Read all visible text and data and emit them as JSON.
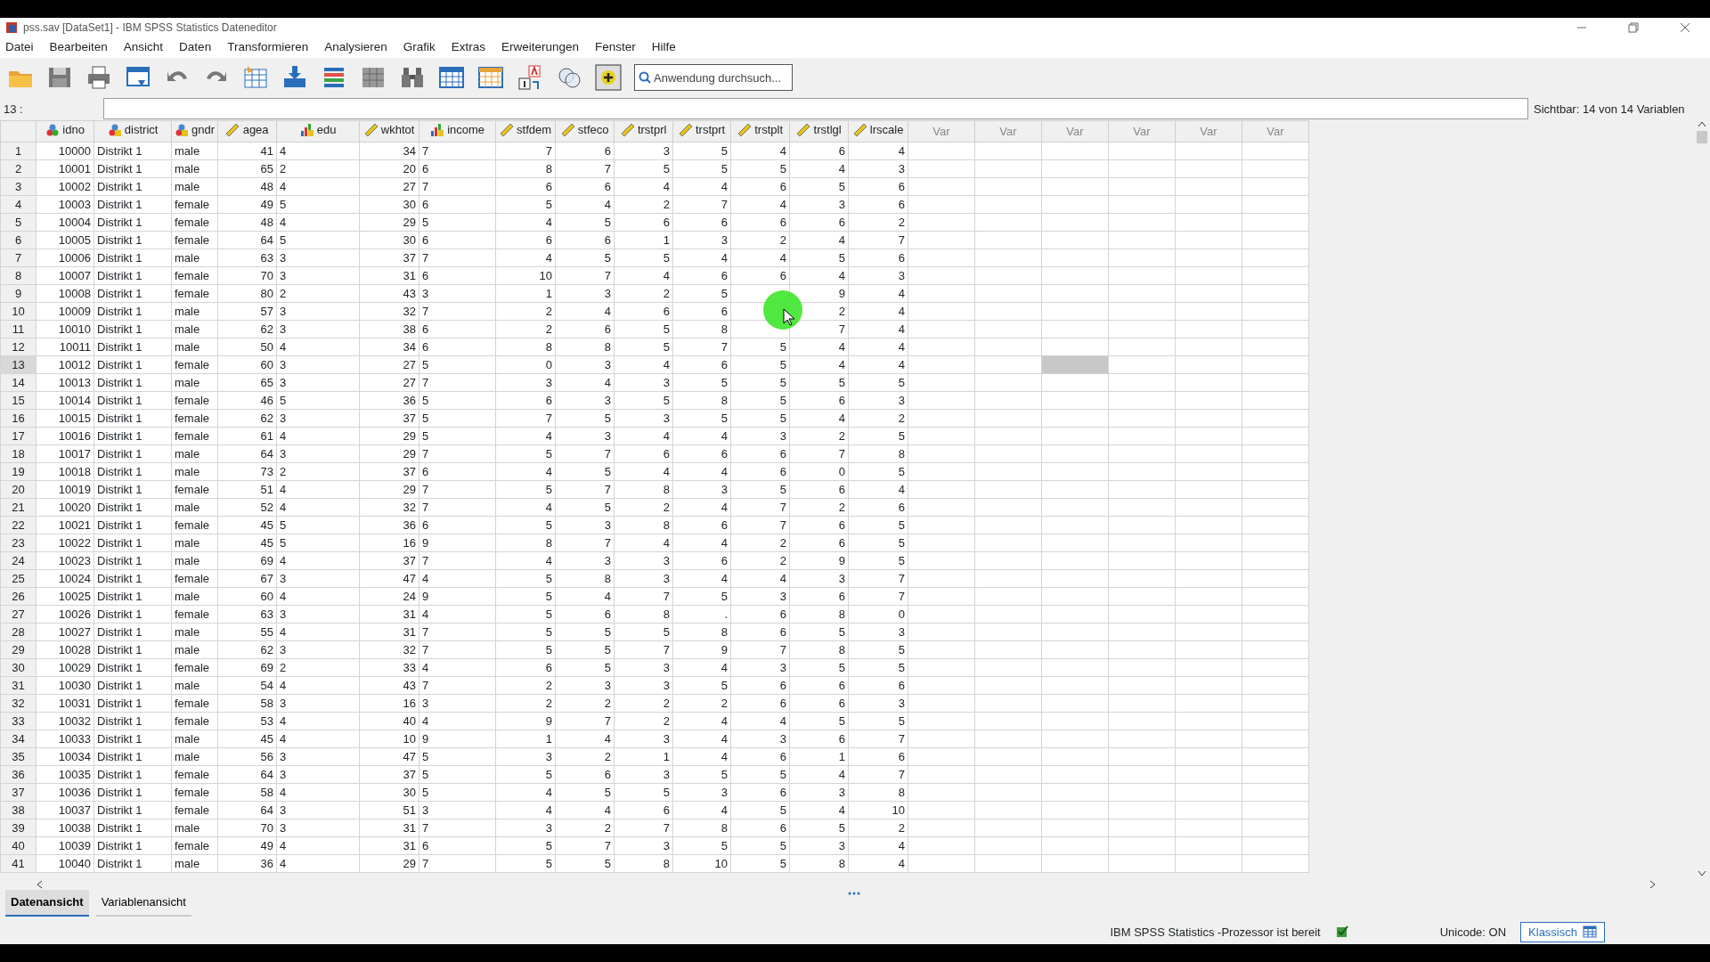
{
  "window": {
    "title": "pss.sav [DataSet1] - IBM SPSS Statistics Dateneditor"
  },
  "menu": [
    {
      "label": "Datei"
    },
    {
      "label": "Bearbeiten"
    },
    {
      "label": "Ansicht"
    },
    {
      "label": "Daten"
    },
    {
      "label": "Transformieren"
    },
    {
      "label": "Analysieren"
    },
    {
      "label": "Grafik"
    },
    {
      "label": "Extras"
    },
    {
      "label": "Erweiterungen"
    },
    {
      "label": "Fenster"
    },
    {
      "label": "Hilfe"
    }
  ],
  "search": {
    "placeholder": "Anwendung durchsuch..."
  },
  "cell_editor": {
    "label": "13 :"
  },
  "visible_info": "Sichtbar: 14 von 14 Variablen",
  "columns": [
    {
      "name": "idno",
      "kind": "nominal"
    },
    {
      "name": "district",
      "kind": "nominal_string"
    },
    {
      "name": "gndr",
      "kind": "nominal_string"
    },
    {
      "name": "agea",
      "kind": "scale"
    },
    {
      "name": "edu",
      "kind": "ordinal_string"
    },
    {
      "name": "wkhtot",
      "kind": "scale"
    },
    {
      "name": "income",
      "kind": "ordinal_string"
    },
    {
      "name": "stfdem",
      "kind": "scale"
    },
    {
      "name": "stfeco",
      "kind": "scale"
    },
    {
      "name": "trstprl",
      "kind": "scale"
    },
    {
      "name": "trstprt",
      "kind": "scale"
    },
    {
      "name": "trstplt",
      "kind": "scale"
    },
    {
      "name": "trstlgl",
      "kind": "scale"
    },
    {
      "name": "lrscale",
      "kind": "scale"
    }
  ],
  "var_columns": [
    {
      "label": "Var",
      "selected": false
    },
    {
      "label": "Var",
      "selected": false
    },
    {
      "label": "Var",
      "selected": true
    },
    {
      "label": "Var",
      "selected": false
    },
    {
      "label": "Var",
      "selected": false
    },
    {
      "label": "Var",
      "selected": false
    }
  ],
  "rows": [
    {
      "label": "1",
      "selected": false,
      "cells": [
        "10000",
        "Distrikt 1",
        "male",
        "41",
        "4",
        "34",
        "7",
        "7",
        "6",
        "3",
        "5",
        "4",
        "6",
        "4"
      ]
    },
    {
      "label": "2",
      "selected": false,
      "cells": [
        "10001",
        "Distrikt 1",
        "male",
        "65",
        "2",
        "20",
        "6",
        "8",
        "7",
        "5",
        "5",
        "5",
        "4",
        "3"
      ]
    },
    {
      "label": "3",
      "selected": false,
      "cells": [
        "10002",
        "Distrikt 1",
        "male",
        "48",
        "4",
        "27",
        "7",
        "6",
        "6",
        "4",
        "4",
        "6",
        "5",
        "6"
      ]
    },
    {
      "label": "4",
      "selected": false,
      "cells": [
        "10003",
        "Distrikt 1",
        "female",
        "49",
        "5",
        "30",
        "6",
        "5",
        "4",
        "2",
        "7",
        "4",
        "3",
        "6"
      ]
    },
    {
      "label": "5",
      "selected": false,
      "cells": [
        "10004",
        "Distrikt 1",
        "female",
        "48",
        "4",
        "29",
        "5",
        "4",
        "5",
        "6",
        "6",
        "6",
        "6",
        "2"
      ]
    },
    {
      "label": "6",
      "selected": false,
      "cells": [
        "10005",
        "Distrikt 1",
        "female",
        "64",
        "5",
        "30",
        "6",
        "6",
        "6",
        "1",
        "3",
        "2",
        "4",
        "7"
      ]
    },
    {
      "label": "7",
      "selected": false,
      "cells": [
        "10006",
        "Distrikt 1",
        "male",
        "63",
        "3",
        "37",
        "7",
        "4",
        "5",
        "5",
        "4",
        "4",
        "5",
        "6"
      ]
    },
    {
      "label": "8",
      "selected": false,
      "cells": [
        "10007",
        "Distrikt 1",
        "female",
        "70",
        "3",
        "31",
        "6",
        "10",
        "7",
        "4",
        "6",
        "6",
        "4",
        "3"
      ]
    },
    {
      "label": "9",
      "selected": false,
      "cells": [
        "10008",
        "Distrikt 1",
        "female",
        "80",
        "2",
        "43",
        "3",
        "1",
        "3",
        "2",
        "5",
        null,
        "9",
        "4"
      ]
    },
    {
      "label": "10",
      "selected": false,
      "cells": [
        "10009",
        "Distrikt 1",
        "male",
        "57",
        "3",
        "32",
        "7",
        "2",
        "4",
        "6",
        "6",
        null,
        "2",
        "4"
      ]
    },
    {
      "label": "11",
      "selected": false,
      "cells": [
        "10010",
        "Distrikt 1",
        "male",
        "62",
        "3",
        "38",
        "6",
        "2",
        "6",
        "5",
        "8",
        null,
        "7",
        "4"
      ]
    },
    {
      "label": "12",
      "selected": false,
      "cells": [
        "10011",
        "Distrikt 1",
        "male",
        "50",
        "4",
        "34",
        "6",
        "8",
        "8",
        "5",
        "7",
        "5",
        "4",
        "4"
      ]
    },
    {
      "label": "13",
      "selected": true,
      "cells": [
        "10012",
        "Distrikt 1",
        "female",
        "60",
        "3",
        "27",
        "5",
        "0",
        "3",
        "4",
        "6",
        "5",
        "4",
        "4"
      ]
    },
    {
      "label": "14",
      "selected": false,
      "cells": [
        "10013",
        "Distrikt 1",
        "male",
        "65",
        "3",
        "27",
        "7",
        "3",
        "4",
        "3",
        "5",
        "5",
        "5",
        "5"
      ]
    },
    {
      "label": "15",
      "selected": false,
      "cells": [
        "10014",
        "Distrikt 1",
        "female",
        "46",
        "5",
        "36",
        "5",
        "6",
        "3",
        "5",
        "8",
        "5",
        "6",
        "3"
      ]
    },
    {
      "label": "16",
      "selected": false,
      "cells": [
        "10015",
        "Distrikt 1",
        "female",
        "62",
        "3",
        "37",
        "5",
        "7",
        "5",
        "3",
        "5",
        "5",
        "4",
        "2"
      ]
    },
    {
      "label": "17",
      "selected": false,
      "cells": [
        "10016",
        "Distrikt 1",
        "female",
        "61",
        "4",
        "29",
        "5",
        "4",
        "3",
        "4",
        "4",
        "3",
        "2",
        "5"
      ]
    },
    {
      "label": "18",
      "selected": false,
      "cells": [
        "10017",
        "Distrikt 1",
        "male",
        "64",
        "3",
        "29",
        "7",
        "5",
        "7",
        "6",
        "6",
        "6",
        "7",
        "8"
      ]
    },
    {
      "label": "19",
      "selected": false,
      "cells": [
        "10018",
        "Distrikt 1",
        "male",
        "73",
        "2",
        "37",
        "6",
        "4",
        "5",
        "4",
        "4",
        "6",
        "0",
        "5"
      ]
    },
    {
      "label": "20",
      "selected": false,
      "cells": [
        "10019",
        "Distrikt 1",
        "female",
        "51",
        "4",
        "29",
        "7",
        "5",
        "7",
        "8",
        "3",
        "5",
        "6",
        "4"
      ]
    },
    {
      "label": "21",
      "selected": false,
      "cells": [
        "10020",
        "Distrikt 1",
        "male",
        "52",
        "4",
        "32",
        "7",
        "4",
        "5",
        "2",
        "4",
        "7",
        "2",
        "6"
      ]
    },
    {
      "label": "22",
      "selected": false,
      "cells": [
        "10021",
        "Distrikt 1",
        "female",
        "45",
        "5",
        "36",
        "6",
        "5",
        "3",
        "8",
        "6",
        "7",
        "6",
        "5"
      ]
    },
    {
      "label": "23",
      "selected": false,
      "cells": [
        "10022",
        "Distrikt 1",
        "male",
        "45",
        "5",
        "16",
        "9",
        "8",
        "7",
        "4",
        "4",
        "2",
        "6",
        "5"
      ]
    },
    {
      "label": "24",
      "selected": false,
      "cells": [
        "10023",
        "Distrikt 1",
        "male",
        "69",
        "4",
        "37",
        "7",
        "4",
        "3",
        "3",
        "6",
        "2",
        "9",
        "5"
      ]
    },
    {
      "label": "25",
      "selected": false,
      "cells": [
        "10024",
        "Distrikt 1",
        "female",
        "67",
        "3",
        "47",
        "4",
        "5",
        "8",
        "3",
        "4",
        "4",
        "3",
        "7"
      ]
    },
    {
      "label": "26",
      "selected": false,
      "cells": [
        "10025",
        "Distrikt 1",
        "male",
        "60",
        "4",
        "24",
        "9",
        "5",
        "4",
        "7",
        "5",
        "3",
        "6",
        "7"
      ]
    },
    {
      "label": "27",
      "selected": false,
      "cells": [
        "10026",
        "Distrikt 1",
        "female",
        "63",
        "3",
        "31",
        "4",
        "5",
        "6",
        "8",
        ".",
        "6",
        "8",
        "0"
      ]
    },
    {
      "label": "28",
      "selected": false,
      "cells": [
        "10027",
        "Distrikt 1",
        "male",
        "55",
        "4",
        "31",
        "7",
        "5",
        "5",
        "5",
        "8",
        "6",
        "5",
        "3"
      ]
    },
    {
      "label": "29",
      "selected": false,
      "cells": [
        "10028",
        "Distrikt 1",
        "male",
        "62",
        "3",
        "32",
        "7",
        "5",
        "5",
        "7",
        "9",
        "7",
        "8",
        "5"
      ]
    },
    {
      "label": "30",
      "selected": false,
      "cells": [
        "10029",
        "Distrikt 1",
        "female",
        "69",
        "2",
        "33",
        "4",
        "6",
        "5",
        "3",
        "4",
        "3",
        "5",
        "5"
      ]
    },
    {
      "label": "31",
      "selected": false,
      "cells": [
        "10030",
        "Distrikt 1",
        "male",
        "54",
        "4",
        "43",
        "7",
        "2",
        "3",
        "3",
        "5",
        "6",
        "6",
        "6"
      ]
    },
    {
      "label": "32",
      "selected": false,
      "cells": [
        "10031",
        "Distrikt 1",
        "female",
        "58",
        "3",
        "16",
        "3",
        "2",
        "2",
        "2",
        "2",
        "6",
        "6",
        "3"
      ]
    },
    {
      "label": "33",
      "selected": false,
      "cells": [
        "10032",
        "Distrikt 1",
        "female",
        "53",
        "4",
        "40",
        "4",
        "9",
        "7",
        "2",
        "4",
        "4",
        "5",
        "5"
      ]
    },
    {
      "label": "34",
      "selected": false,
      "cells": [
        "10033",
        "Distrikt 1",
        "male",
        "45",
        "4",
        "10",
        "9",
        "1",
        "4",
        "3",
        "4",
        "3",
        "6",
        "7"
      ]
    },
    {
      "label": "35",
      "selected": false,
      "cells": [
        "10034",
        "Distrikt 1",
        "male",
        "56",
        "3",
        "47",
        "5",
        "3",
        "2",
        "1",
        "4",
        "6",
        "1",
        "6"
      ]
    },
    {
      "label": "36",
      "selected": false,
      "cells": [
        "10035",
        "Distrikt 1",
        "female",
        "64",
        "3",
        "37",
        "5",
        "5",
        "6",
        "3",
        "5",
        "5",
        "4",
        "7"
      ]
    },
    {
      "label": "37",
      "selected": false,
      "cells": [
        "10036",
        "Distrikt 1",
        "female",
        "58",
        "4",
        "30",
        "5",
        "4",
        "5",
        "5",
        "3",
        "6",
        "3",
        "8"
      ]
    },
    {
      "label": "38",
      "selected": false,
      "cells": [
        "10037",
        "Distrikt 1",
        "female",
        "64",
        "3",
        "51",
        "3",
        "4",
        "4",
        "6",
        "4",
        "5",
        "4",
        "10"
      ]
    },
    {
      "label": "39",
      "selected": false,
      "cells": [
        "10038",
        "Distrikt 1",
        "male",
        "70",
        "3",
        "31",
        "7",
        "3",
        "2",
        "7",
        "8",
        "6",
        "5",
        "2"
      ]
    },
    {
      "label": "40",
      "selected": false,
      "cells": [
        "10039",
        "Distrikt 1",
        "female",
        "49",
        "4",
        "31",
        "6",
        "5",
        "7",
        "3",
        "5",
        "5",
        "3",
        "4"
      ]
    },
    {
      "label": "41",
      "selected": false,
      "cells": [
        "10040",
        "Distrikt 1",
        "male",
        "36",
        "4",
        "29",
        "7",
        "5",
        "5",
        "8",
        "10",
        "5",
        "8",
        "4"
      ]
    }
  ],
  "view_tabs": [
    {
      "label": "Datenansicht",
      "selected": true
    },
    {
      "label": "Variablenansicht",
      "selected": false
    }
  ],
  "status": {
    "processor": "IBM SPSS Statistics -Prozessor ist bereit",
    "unicode": "Unicode: ON",
    "mode_button": "Klassisch"
  }
}
